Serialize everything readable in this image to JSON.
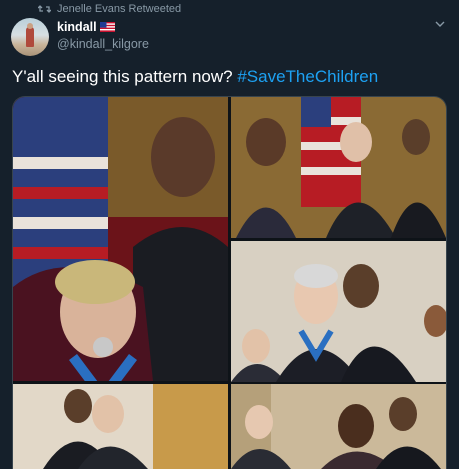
{
  "retweet": {
    "text": "Jenelle Evans Retweeted"
  },
  "author": {
    "name": "kindall",
    "handle": "@kindall_kilgore"
  },
  "tweet": {
    "text": "Y'all seeing this pattern now?",
    "hashtag": "#SaveTheChildren"
  },
  "media": {
    "images": [
      {
        "name": "medal-photo-1"
      },
      {
        "name": "medal-photo-2"
      },
      {
        "name": "medal-photo-3"
      },
      {
        "name": "medal-photo-4"
      },
      {
        "name": "medal-photo-5"
      }
    ]
  },
  "colors": {
    "background": "#15202b",
    "hashtag": "#1da1f2",
    "muted": "#8899a6"
  },
  "icons": [
    "retweet-icon",
    "us-flag-icon",
    "chevron-down-icon"
  ]
}
